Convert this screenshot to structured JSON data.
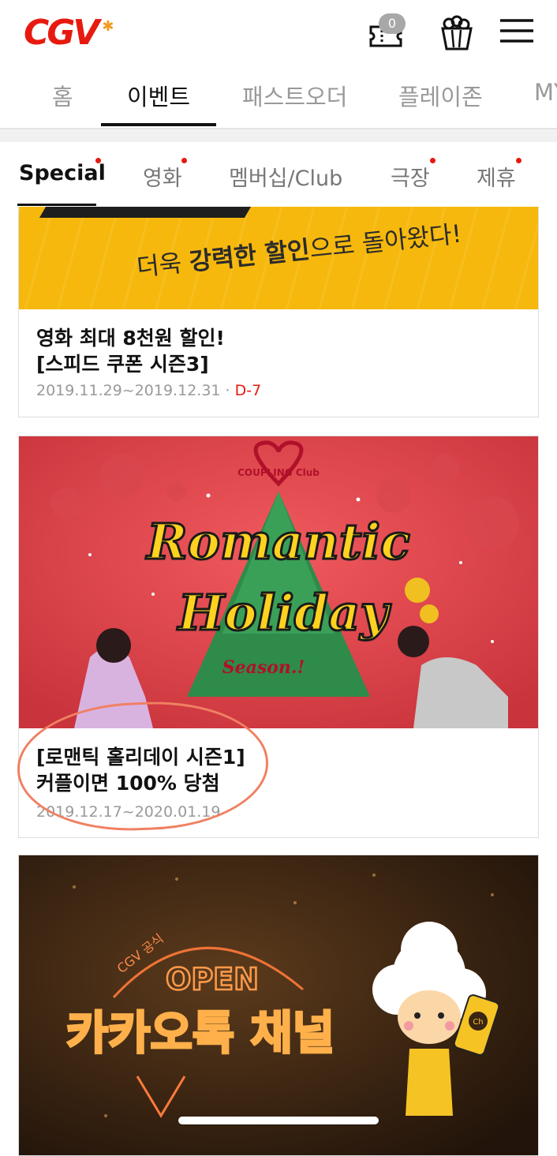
{
  "header": {
    "logo": "CGV",
    "ticket_badge": "0",
    "icons": [
      "ticket-icon",
      "popcorn-icon",
      "menu-icon"
    ]
  },
  "top_nav": {
    "tabs": [
      {
        "label": "홈",
        "active": false
      },
      {
        "label": "이벤트",
        "active": true
      },
      {
        "label": "패스트오더",
        "active": false
      },
      {
        "label": "플레이존",
        "active": false
      },
      {
        "label": "MY",
        "active": false
      }
    ]
  },
  "sub_nav": {
    "tabs": [
      {
        "label": "Special",
        "active": true,
        "dot": true
      },
      {
        "label": "영화",
        "active": false,
        "dot": true
      },
      {
        "label": "멤버십/Club",
        "active": false,
        "dot": false
      },
      {
        "label": "극장",
        "active": false,
        "dot": true
      },
      {
        "label": "제휴",
        "active": false,
        "dot": true
      }
    ]
  },
  "events": [
    {
      "banner_text_pre": "더욱 ",
      "banner_text_bold": "강력한 할인",
      "banner_text_post": "으로 돌아왔다!",
      "title_line1": "영화 최대 8천원 할인!",
      "title_line2": "[스피드 쿠폰 시즌3]",
      "date": "2019.11.29~2019.12.31",
      "dday": "D-7"
    },
    {
      "banner_logo": "COUPLING Club",
      "banner_line1": "Romantic",
      "banner_line2": "Holiday",
      "banner_line3": "Season.!",
      "title_line1": "[로맨틱 홀리데이 시즌1]",
      "title_line2": "커플이면 100% 당첨",
      "date": "2019.12.17~2020.01.19"
    },
    {
      "banner_small": "CGV 공식",
      "banner_open": "OPEN",
      "banner_main": "카카오톡 채널",
      "banner_badge": "Ch"
    }
  ],
  "colors": {
    "brand_red": "#e71a0f",
    "yellow_banner": "#f6b80c",
    "red_banner": "#e03f45",
    "brown_banner": "#3a2412",
    "highlight": "#f08062"
  }
}
